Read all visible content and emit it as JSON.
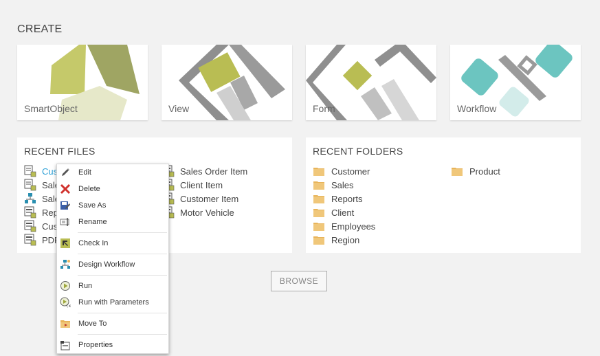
{
  "create": {
    "title": "CREATE",
    "tiles": [
      {
        "label": "SmartObject"
      },
      {
        "label": "View"
      },
      {
        "label": "Form"
      },
      {
        "label": "Workflow"
      }
    ]
  },
  "recent_files": {
    "title": "RECENT FILES",
    "col1": [
      "Cus",
      "Sale",
      "Sale",
      "Rep",
      "Cus",
      "PDF"
    ],
    "col2": [
      "Sales Order Item",
      "Client Item",
      "Customer Item",
      "Motor Vehicle"
    ]
  },
  "recent_folders": {
    "title": "RECENT FOLDERS",
    "col1": [
      "Customer",
      "Sales",
      "Reports",
      "Client",
      "Employees",
      "Region"
    ],
    "col2": [
      "Product"
    ]
  },
  "browse_label": "BROWSE",
  "context_menu": {
    "items": [
      "Edit",
      "Delete",
      "Save As",
      "Rename",
      "Check In",
      "Design Workflow",
      "Run",
      "Run with Parameters",
      "Move To",
      "Properties"
    ]
  },
  "colors": {
    "link": "#2a9fd6",
    "olive": "#b9bf55",
    "teal": "#6cc5c0",
    "folder": "#e8b45a"
  }
}
